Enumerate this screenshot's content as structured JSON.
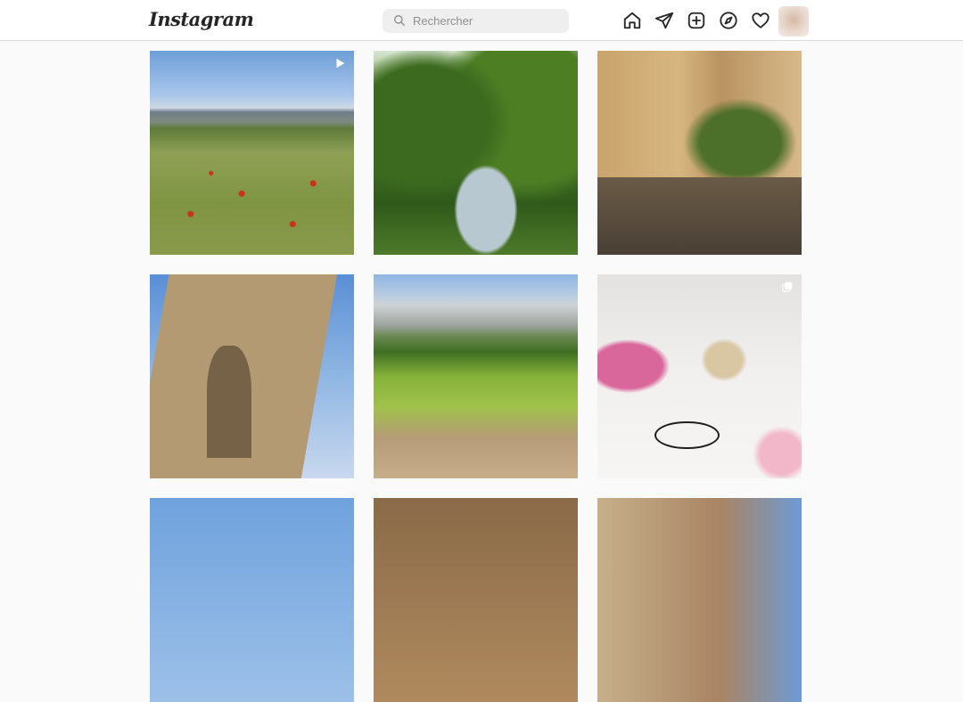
{
  "header": {
    "logo_text": "Instagram",
    "search_placeholder": "Rechercher",
    "nav_icons": [
      "home-icon",
      "direct-messages-icon",
      "new-post-icon",
      "explore-icon",
      "activity-heart-icon"
    ],
    "avatar": "profile-avatar"
  },
  "grid": {
    "posts": [
      {
        "scene": "poppy field with mountain",
        "badge": "reel-icon"
      },
      {
        "scene": "formal garden with fountain",
        "badge": ""
      },
      {
        "scene": "town square with fountain and café terraces",
        "badge": ""
      },
      {
        "scene": "medieval stone tower",
        "badge": ""
      },
      {
        "scene": "vineyard below a mountain",
        "badge": ""
      },
      {
        "scene": "jewellery bracelets and pouch with peony",
        "badge": "carousel-icon"
      },
      {
        "scene": "sky and tree",
        "badge": ""
      },
      {
        "scene": "stone architecture",
        "badge": ""
      },
      {
        "scene": "rocky cliff",
        "badge": ""
      }
    ]
  },
  "colors": {
    "background": "#fafafa",
    "header_bg": "#ffffff",
    "border": "#dbdbdb",
    "icon": "#262626",
    "search_bg": "#efefef",
    "placeholder": "#8e8e8e"
  }
}
